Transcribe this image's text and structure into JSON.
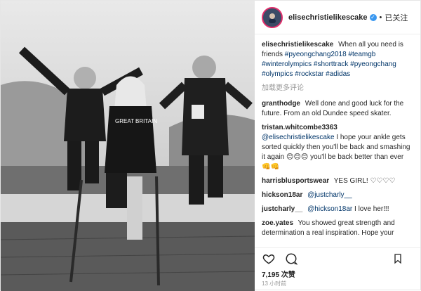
{
  "header": {
    "avatar_icon": "avatar-icon",
    "username": "elisechristielikescake",
    "verified_icon": "verified-badge-icon",
    "separator": "•",
    "follow_status": "已关注"
  },
  "caption": {
    "username": "elisechristielikescake",
    "text": "When all you need is friends",
    "hashtags": "#pyeongchang2018 #teamgb #winterolympics #shorttrack #pyeongchang #olympics #rockstar #adidas"
  },
  "load_more": "加载更多评论",
  "comments": [
    {
      "username": "granthodge",
      "text": "Well done and good luck for the future. From an old Dundee speed skater."
    },
    {
      "username": "tristan.whitcombe3363",
      "mention": "@elisechristielikescake",
      "text": "I hope your ankle gets sorted quickly then you'll be back and smashing it again 😊😊😊 you'll be back better than ever 👊👊"
    },
    {
      "username": "harrisblusportswear",
      "text": "YES GIRL! ♡♡♡♡"
    },
    {
      "username": "hickson18ar",
      "mention": "@justcharly__",
      "text": ""
    },
    {
      "username": "justcharly__",
      "mention": "@hickson18ar",
      "text": "I love her!!!"
    },
    {
      "username": "zoe.yates",
      "text": "You showed great strength and determination a real inspiration. Hope your"
    }
  ],
  "actions": {
    "like_icon": "heart-icon",
    "comment_icon": "comment-icon",
    "save_icon": "bookmark-icon"
  },
  "likes": "7,195 次赞",
  "timestamp": "13 小时前",
  "photo": {
    "badge_text": "GREAT BRITAIN"
  }
}
